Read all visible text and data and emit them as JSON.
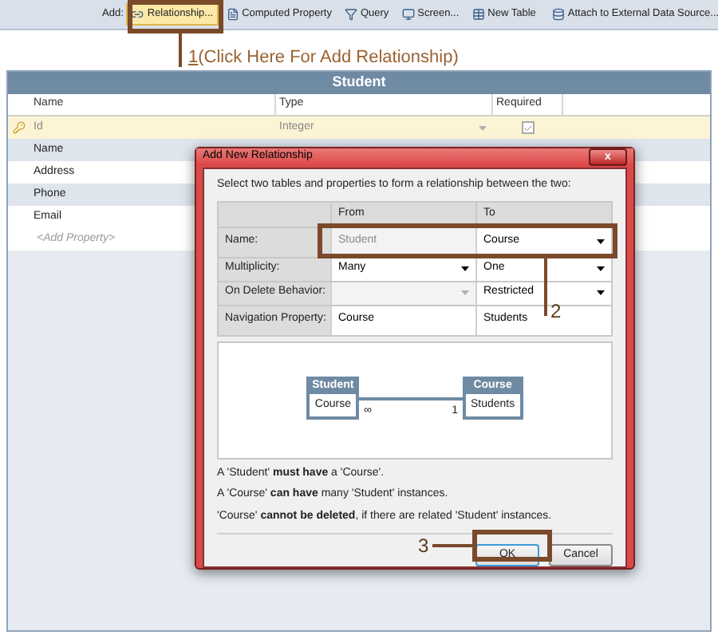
{
  "toolbar": {
    "label": "Add:",
    "items": [
      {
        "kind": "relationship",
        "label": "Relationship...",
        "selected": true
      },
      {
        "kind": "computed",
        "label": "Computed Property",
        "selected": false
      },
      {
        "kind": "query",
        "label": "Query",
        "selected": false
      },
      {
        "kind": "screen",
        "label": "Screen...",
        "selected": false
      },
      {
        "kind": "table",
        "label": "New Table",
        "selected": false
      },
      {
        "kind": "attach",
        "label": "Attach to External Data Source...",
        "selected": false
      }
    ]
  },
  "annotations": [
    {
      "number": "1",
      "text": "(Click Here For Add Relationship)"
    },
    {
      "number": "2"
    },
    {
      "number": "3"
    }
  ],
  "table": {
    "title": "Student",
    "columns": [
      "Name",
      "Type",
      "Required"
    ],
    "rows": [
      {
        "name": "Id",
        "type": "Integer",
        "required": true,
        "key": true,
        "selected": true
      },
      {
        "name": "Name",
        "selected": false
      },
      {
        "name": "Address",
        "selected": false
      },
      {
        "name": "Phone",
        "selected": false
      },
      {
        "name": "Email",
        "selected": false
      }
    ],
    "add_row": "<Add Property>"
  },
  "dialog": {
    "title": "Add New Relationship",
    "close": "x",
    "instruction": "Select two tables and properties to form a relationship between the two:",
    "columns": [
      "From",
      "To"
    ],
    "rows": [
      {
        "label": "Name:",
        "from": {
          "kind": "readonly",
          "value": "Student"
        },
        "to": {
          "kind": "dropdown",
          "value": "Course",
          "disabled": false
        }
      },
      {
        "label": "Multiplicity:",
        "from": {
          "kind": "dropdown",
          "value": "Many",
          "disabled": false
        },
        "to": {
          "kind": "dropdown",
          "value": "One",
          "disabled": false
        }
      },
      {
        "label": "On Delete Behavior:",
        "from": {
          "kind": "dropdown",
          "disabled": true
        },
        "to": {
          "kind": "dropdown",
          "value": "Restricted",
          "disabled": false
        }
      },
      {
        "label": "Navigation Property:",
        "from": {
          "kind": "text",
          "value": "Course"
        },
        "to": {
          "kind": "text",
          "value": "Students"
        }
      }
    ],
    "diagram": {
      "entities": [
        {
          "title": "Student",
          "field": "Course"
        },
        {
          "title": "Course",
          "field": "Students"
        }
      ],
      "from_label": "∞",
      "to_label": "1"
    },
    "statements": [
      "A 'Student' **must have** a 'Course'.",
      "A 'Course' **can have** many 'Student' instances.",
      "'Course' **cannot be deleted**, if there are related 'Student' instances."
    ],
    "buttons": [
      {
        "label": "OK",
        "default": true
      },
      {
        "label": "Cancel",
        "default": false
      }
    ]
  }
}
